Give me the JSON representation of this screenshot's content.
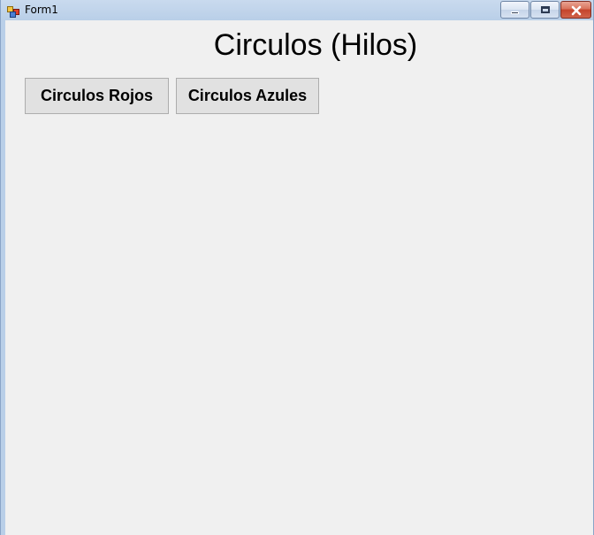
{
  "window": {
    "title": "Form1",
    "caption_buttons": {
      "minimize_icon": "minimize-icon",
      "maximize_icon": "maximize-icon",
      "close_icon": "close-icon"
    }
  },
  "form": {
    "title": "Circulos (Hilos)",
    "buttons": {
      "red_label": "Circulos Rojos",
      "blue_label": "Circulos Azules"
    }
  },
  "colors": {
    "client_background": "#f0f0f0",
    "button_face": "#e1e1e1",
    "button_border": "#adadad",
    "close_button": "#c4442c"
  }
}
